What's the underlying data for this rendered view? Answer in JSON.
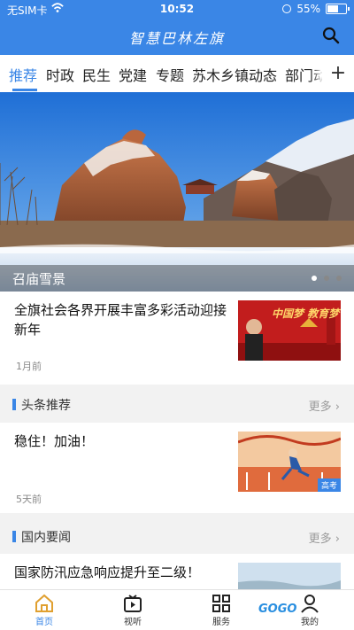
{
  "status": {
    "carrier": "无SIM卡",
    "time": "10:52",
    "battery": "55%"
  },
  "header": {
    "title": "智慧巴林左旗"
  },
  "tabs": [
    "推荐",
    "时政",
    "民生",
    "党建",
    "专题",
    "苏木乡镇动态",
    "部门动态"
  ],
  "tabs_plus": "+",
  "banner": {
    "caption": "召庙雪景",
    "active_index": 0,
    "count": 3
  },
  "cards": [
    {
      "title": "全旗社会各界开展丰富多彩活动迎接新年",
      "meta": "1月前",
      "thumb_text": "中国梦 教育梦"
    },
    {
      "title": "稳住！加油！",
      "meta": "5天前",
      "badge": "高考"
    },
    {
      "title": "国家防汛应急响应提升至二级！"
    }
  ],
  "sections": [
    {
      "name": "头条推荐",
      "more": "更多"
    },
    {
      "name": "国内要闻",
      "more": "更多"
    }
  ],
  "bottom_nav": [
    {
      "label": "首页",
      "icon": "home-icon",
      "active": true
    },
    {
      "label": "视听",
      "icon": "video-icon"
    },
    {
      "label": "服务",
      "icon": "grid-icon"
    },
    {
      "label": "我的",
      "icon": "user-icon"
    }
  ],
  "watermark": "GOGO",
  "colors": {
    "primary": "#3a86e6",
    "background": "#f2f2f2"
  }
}
